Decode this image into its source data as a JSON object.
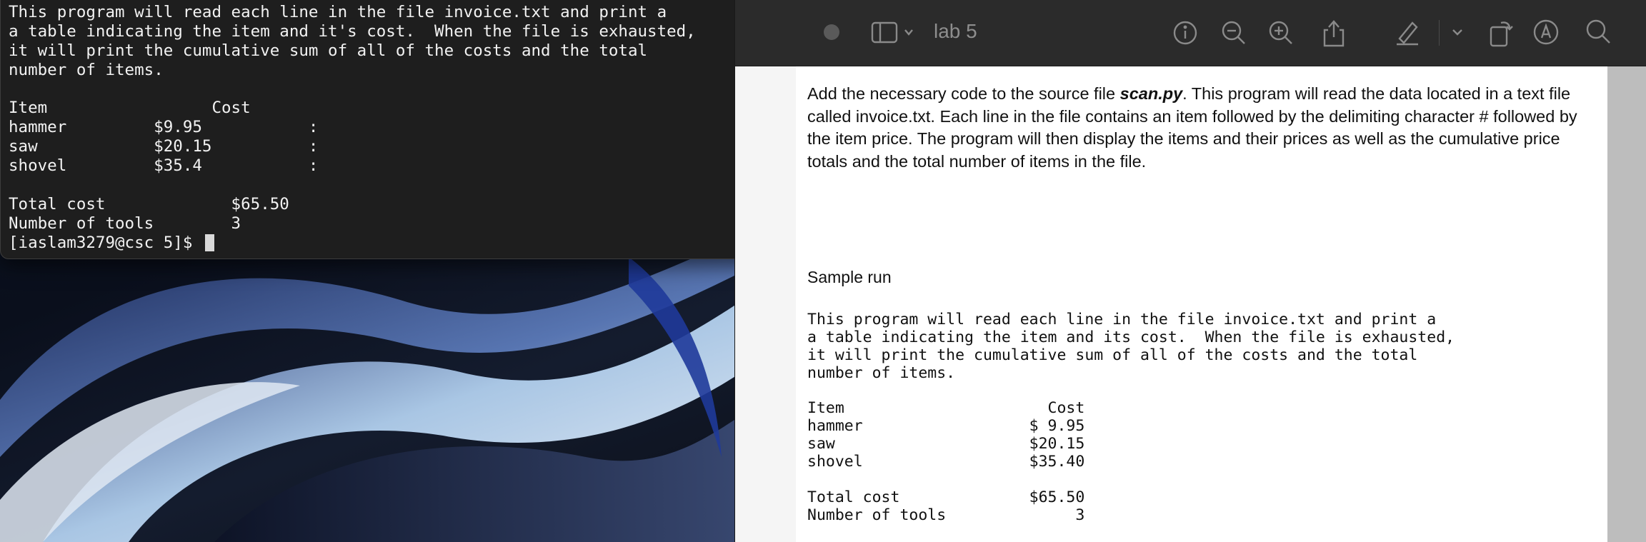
{
  "terminal": {
    "lines": [
      "This program will read each line in the file invoice.txt and print a",
      "a table indicating the item and it's cost.  When the file is exhausted,",
      "it will print the cumulative sum of all of the costs and the total",
      "number of items.",
      "",
      "Item                 Cost",
      "hammer         $9.95           :",
      "saw            $20.15          :",
      "shovel         $35.4           :",
      "",
      "Total cost             $65.50",
      "Number of tools        3"
    ],
    "prompt": "[iaslam3279@csc 5]$ "
  },
  "preview": {
    "title": "lab 5",
    "paragraph_prefix": "Add the necessary code to the source file ",
    "paragraph_filename": "scan.py",
    "paragraph_rest": ". This program will read the data located in a text file called invoice.txt. Each line in the file contains an item followed by the delimiting character # followed by the item price. The program will then display the items and their prices as well as the cumulative price totals and the total number of items in the file.",
    "sample_heading": "Sample run",
    "code_lines": [
      "This program will read each line in the file invoice.txt and print a",
      "a table indicating the item and its cost.  When the file is exhausted,",
      "it will print the cumulative sum of all of the costs and the total",
      "number of items.",
      "",
      "Item                      Cost",
      "hammer                  $ 9.95",
      "saw                     $20.15",
      "shovel                  $35.40",
      "",
      "Total cost              $65.50",
      "Number of tools              3"
    ]
  }
}
